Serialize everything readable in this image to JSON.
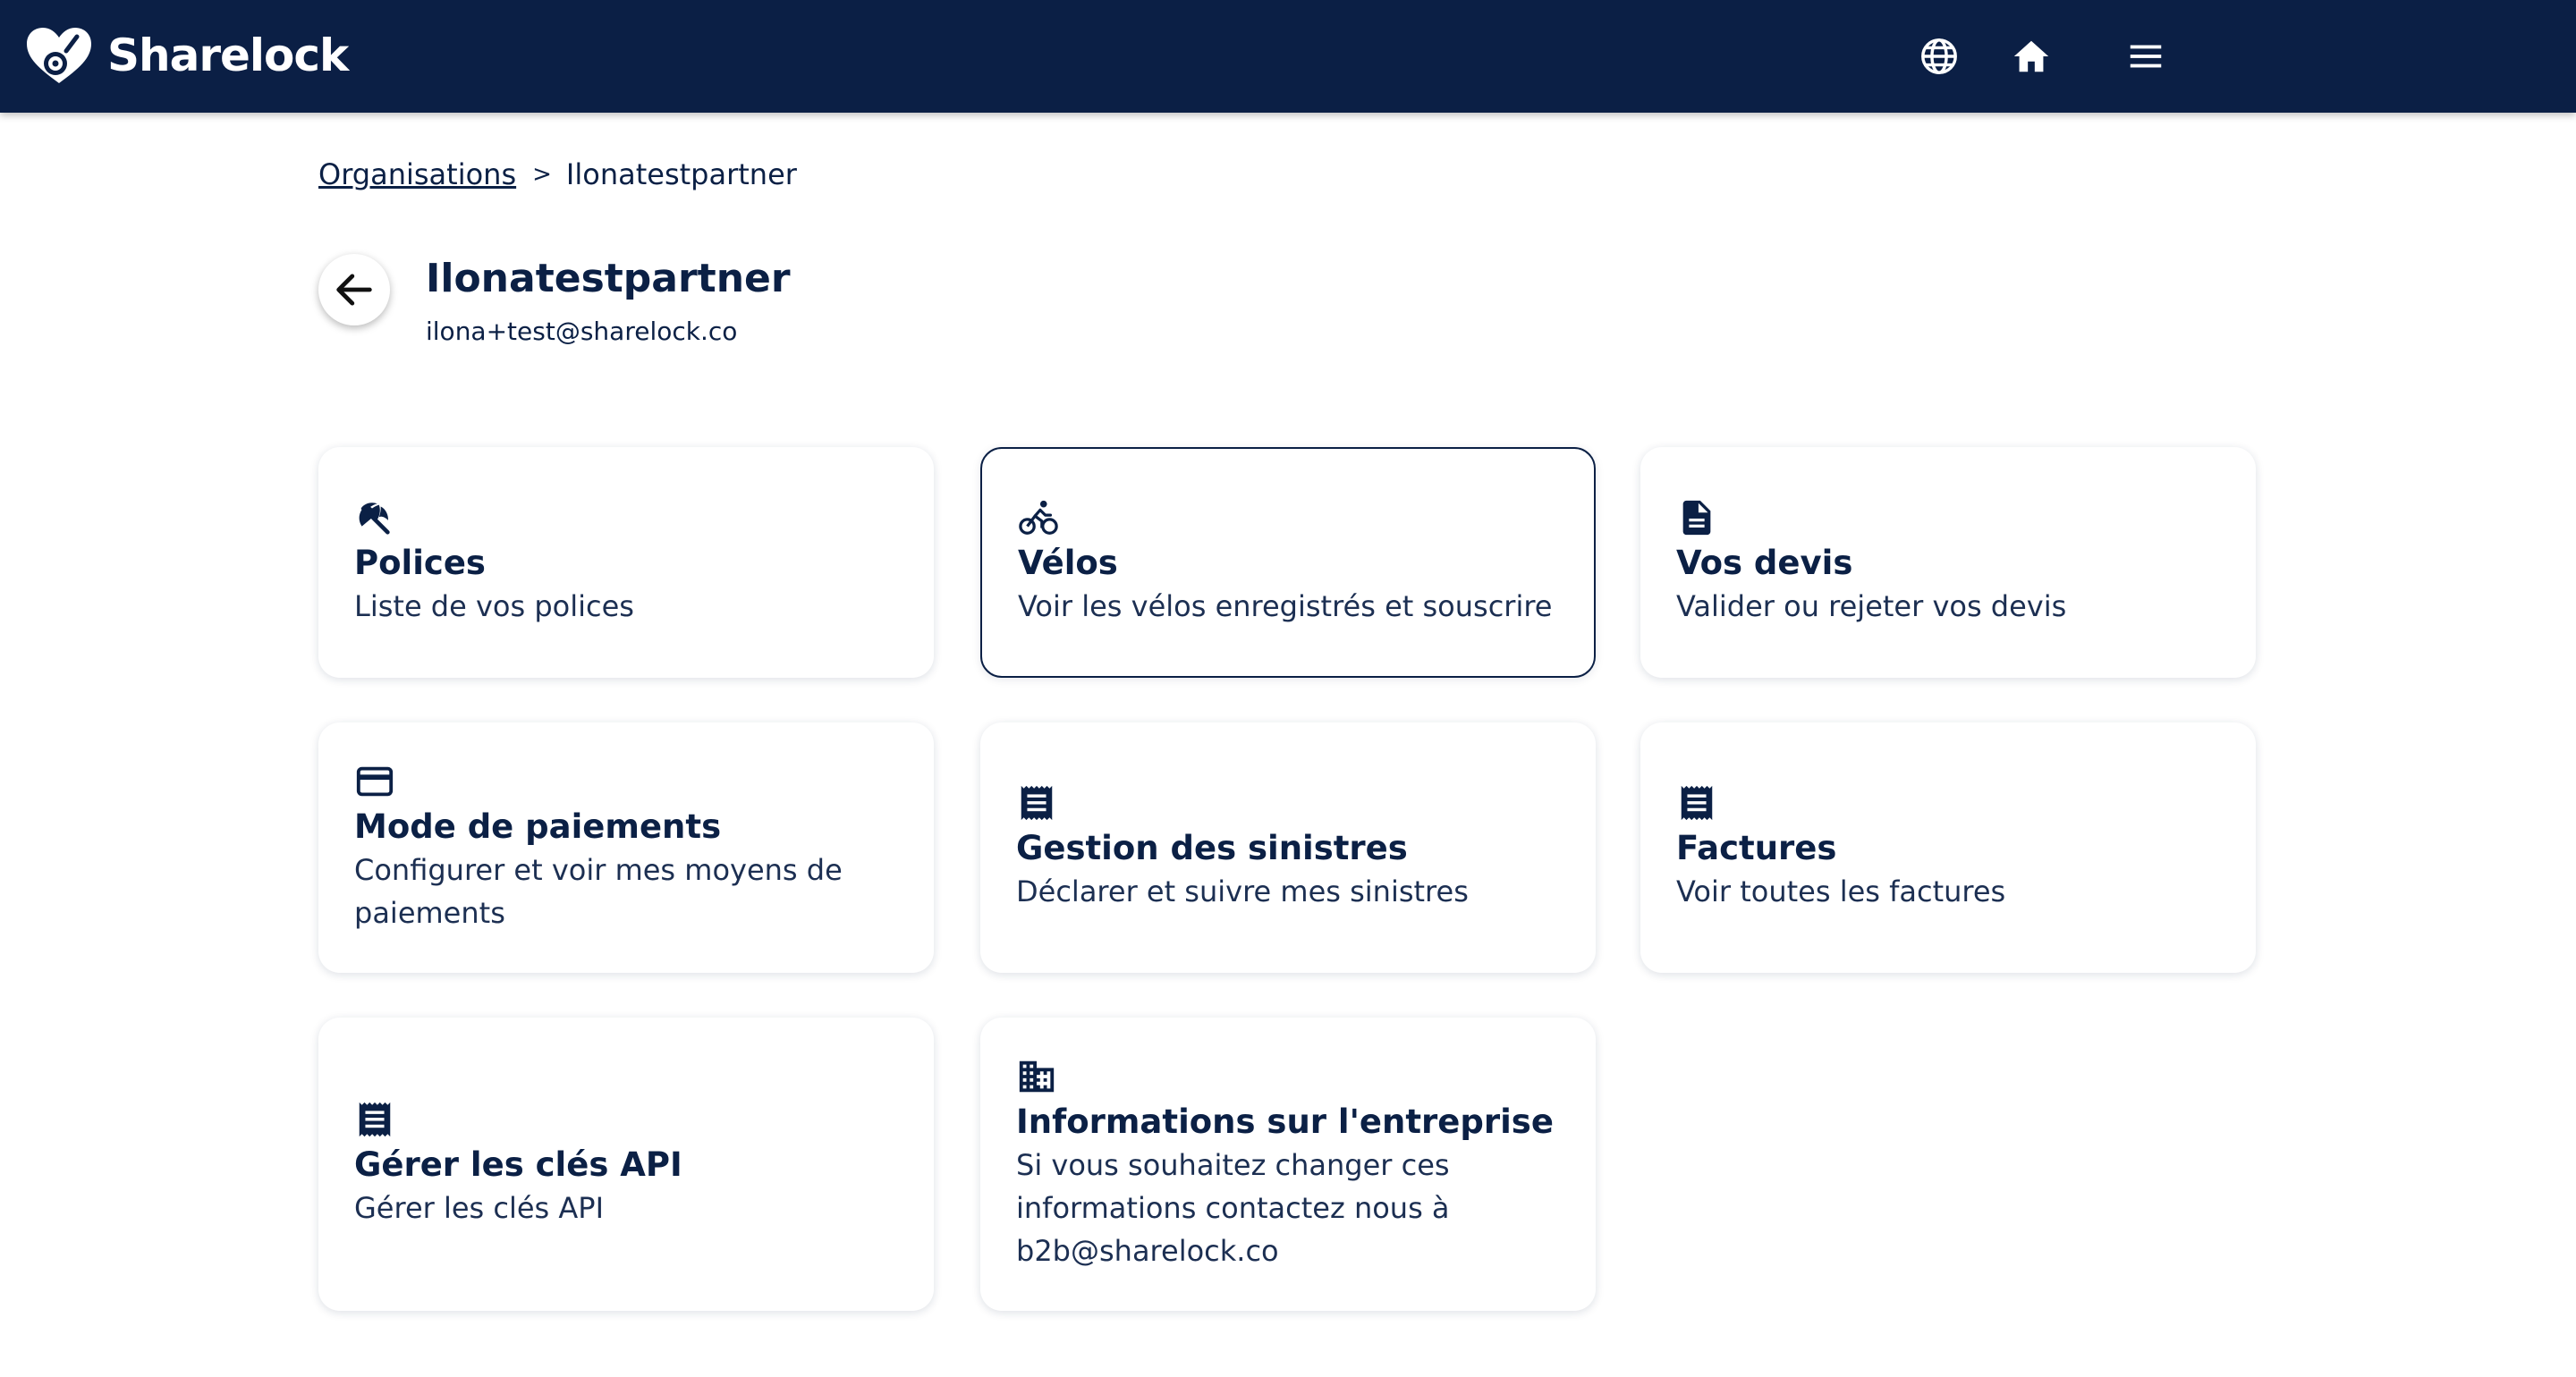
{
  "app": {
    "name": "Sharelock",
    "brand_color": "#0b1f45"
  },
  "topbar": {
    "icons": [
      "globe-icon",
      "home-icon",
      "menu-icon"
    ]
  },
  "breadcrumb": {
    "parent": "Organisations",
    "separator": ">",
    "current": "Ilonatestpartner"
  },
  "header": {
    "title": "Ilonatestpartner",
    "email": "ilona+test@sharelock.co"
  },
  "cards": [
    {
      "icon": "umbrella-icon",
      "title": "Polices",
      "description": "Liste de vos polices",
      "active": false
    },
    {
      "icon": "bike-icon",
      "title": "Vélos",
      "description": "Voir les vélos enregistrés et souscrire",
      "active": true
    },
    {
      "icon": "document-icon",
      "title": "Vos devis",
      "description": "Valider ou rejeter vos devis",
      "active": false
    },
    {
      "icon": "credit-card-icon",
      "title": "Mode de paiements",
      "description": "Configurer et voir mes moyens de paiements",
      "active": false
    },
    {
      "icon": "receipt-icon",
      "title": "Gestion des sinistres",
      "description": "Déclarer et suivre mes sinistres",
      "active": false
    },
    {
      "icon": "receipt-icon",
      "title": "Factures",
      "description": "Voir toutes les factures",
      "active": false
    },
    {
      "icon": "receipt-icon",
      "title": "Gérer les clés API",
      "description": "Gérer les clés API",
      "active": false
    },
    {
      "icon": "building-icon",
      "title": "Informations sur l'entreprise",
      "description": "Si vous souhaitez changer ces informations contactez nous à b2b@sharelock.co",
      "active": false
    }
  ]
}
